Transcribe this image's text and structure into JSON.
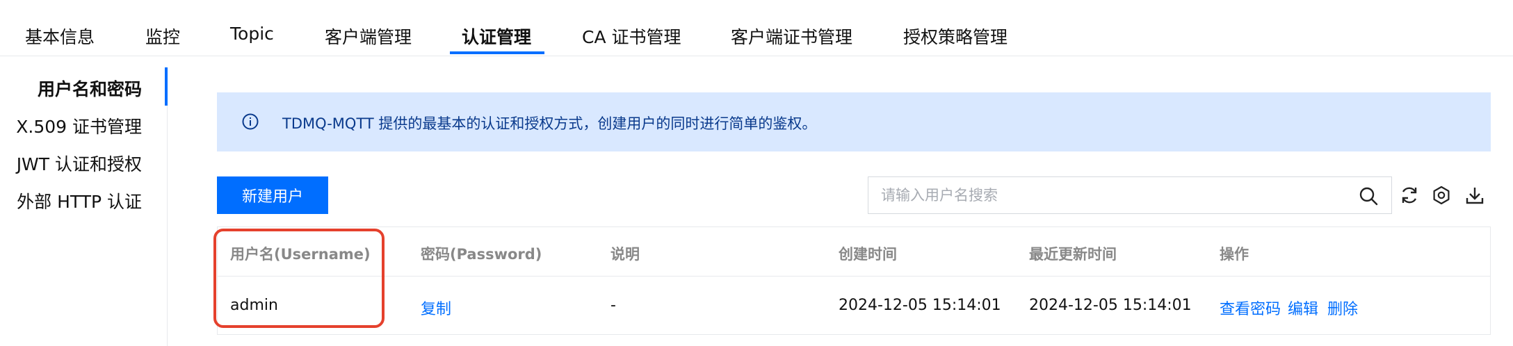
{
  "tabs": [
    {
      "label": "基本信息"
    },
    {
      "label": "监控"
    },
    {
      "label": "Topic"
    },
    {
      "label": "客户端管理"
    },
    {
      "label": "认证管理",
      "active": true
    },
    {
      "label": "CA 证书管理"
    },
    {
      "label": "客户端证书管理"
    },
    {
      "label": "授权策略管理"
    }
  ],
  "sidebar": {
    "items": [
      {
        "label": "用户名和密码",
        "active": true
      },
      {
        "label": "X.509 证书管理"
      },
      {
        "label": "JWT 认证和授权"
      },
      {
        "label": "外部 HTTP 认证"
      }
    ]
  },
  "notice": {
    "icon": "info-icon",
    "text": "TDMQ-MQTT 提供的最基本的认证和授权方式，创建用户的同时进行简单的鉴权。"
  },
  "toolbar": {
    "new_user_label": "新建用户",
    "search_placeholder": "请输入用户名搜索",
    "search_value": "",
    "icons": [
      "search-icon",
      "refresh-icon",
      "settings-icon",
      "download-icon"
    ]
  },
  "table": {
    "columns": [
      "用户名(Username)",
      "密码(Password)",
      "说明",
      "创建时间",
      "最近更新时间",
      "操作"
    ],
    "rows": [
      {
        "username": "admin",
        "password_action": "复制",
        "description": "-",
        "created": "2024-12-05 15:14:01",
        "updated": "2024-12-05 15:14:01",
        "actions": [
          "查看密码",
          "编辑",
          "删除"
        ]
      }
    ]
  },
  "colors": {
    "accent": "#006eff",
    "notice_bg": "#d9e8ff",
    "notice_text": "#0a3a8c",
    "highlight": "#e5412d"
  }
}
